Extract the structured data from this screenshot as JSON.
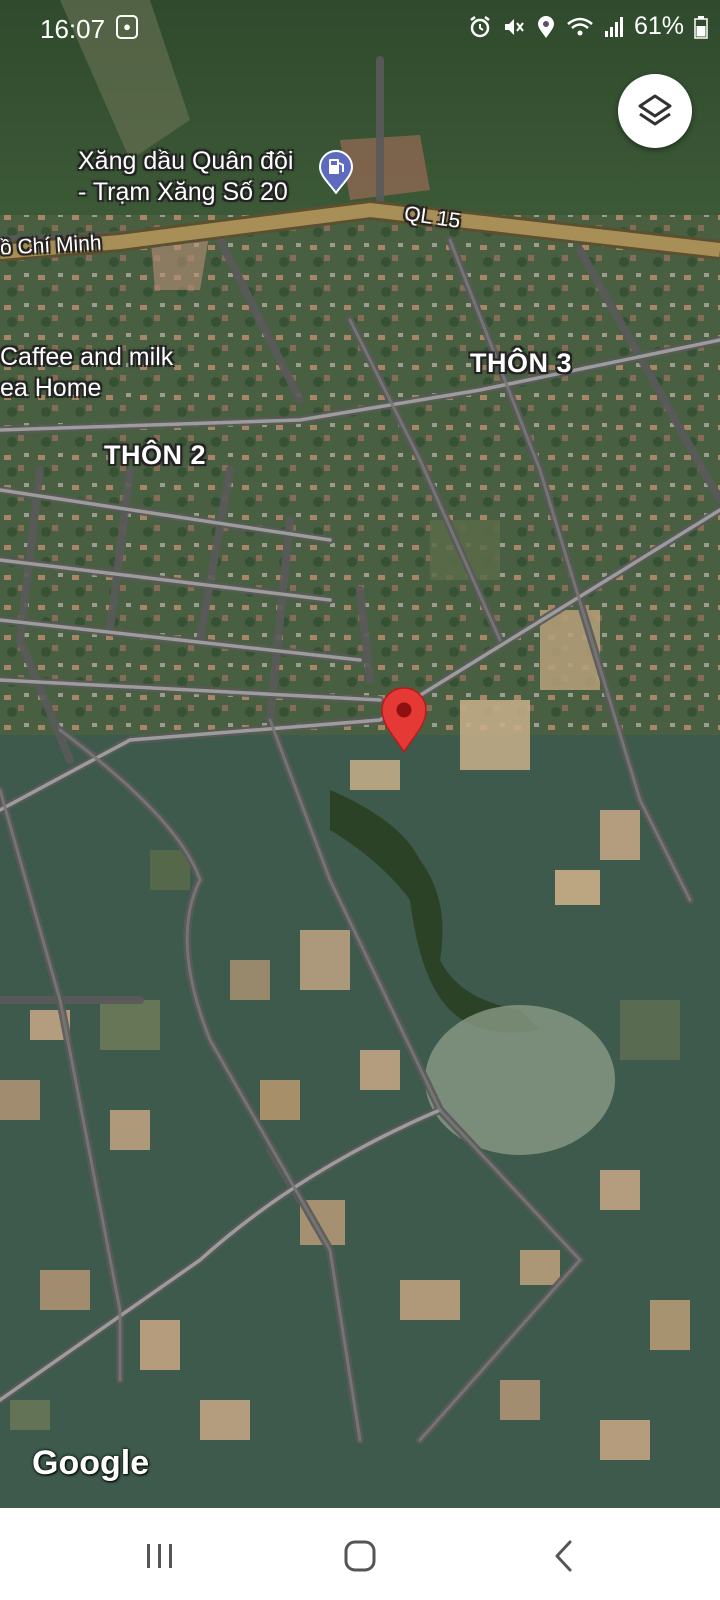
{
  "status_bar": {
    "time": "16:07",
    "battery_percent": "61%",
    "icons": [
      "screen-record-icon",
      "alarm-icon",
      "mute-icon",
      "location-icon",
      "wifi-icon",
      "signal-icon",
      "battery-icon"
    ]
  },
  "map": {
    "type": "satellite",
    "poi_labels": {
      "gas_station_line1": "Xăng dầu Quân đội",
      "gas_station_line2": "- Trạm Xăng Số 20",
      "cafe_line1": "Caffee and milk",
      "cafe_line2": "ea Home"
    },
    "area_labels": {
      "thon_3": "THÔN 3",
      "thon_2": "THÔN 2"
    },
    "road_labels": {
      "ql15": "QL 15",
      "ho_chi_minh": "ồ Chí Minh"
    },
    "pin_color": "#e53935",
    "attribution": "Google"
  },
  "controls": {
    "layers_icon": "layers-icon"
  },
  "nav_bar": {
    "buttons": [
      "recent-apps-icon",
      "home-icon",
      "back-icon"
    ]
  }
}
